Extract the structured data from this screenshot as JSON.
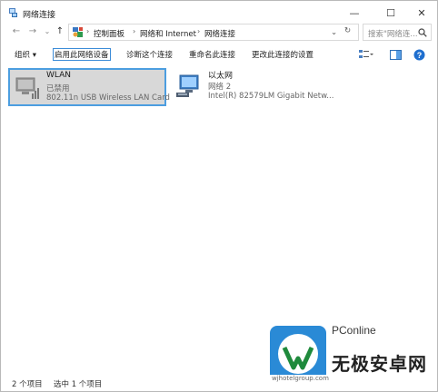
{
  "window": {
    "title": "网络连接",
    "minimize": "—",
    "maximize": "☐",
    "close": "✕"
  },
  "address": {
    "back": "←",
    "forward": "→",
    "recent": "⌄",
    "up": "↑",
    "crumbs": [
      "控制面板",
      "网络和 Internet",
      "网络连接"
    ],
    "separator": "›",
    "dropdown": "⌄",
    "refresh": "↻",
    "search_placeholder": "搜索\"网络连..."
  },
  "commands": {
    "organize": "组织 ▾",
    "enable": "启用此网络设备",
    "diagnose": "诊断这个连接",
    "rename": "重命名此连接",
    "change_settings": "更改此连接的设置"
  },
  "connections": [
    {
      "name": "WLAN",
      "status": "已禁用",
      "adapter": "802.11n USB Wireless LAN Card"
    },
    {
      "name": "以太网",
      "status": "网络 2",
      "adapter": "Intel(R) 82579LM Gigabit Netw..."
    }
  ],
  "status": {
    "count": "2 个项目",
    "selected": "选中 1 个项目"
  },
  "watermark": {
    "brand": "PConline",
    "name": "无极安卓网",
    "url": "wjhotelgroup.com"
  },
  "colors": {
    "accent": "#3c8cd8",
    "selection": "#d8d8d8",
    "selection_border": "#4c9ee0",
    "watermark_green": "#1f8a3c",
    "watermark_blue": "#2a8ad6"
  }
}
